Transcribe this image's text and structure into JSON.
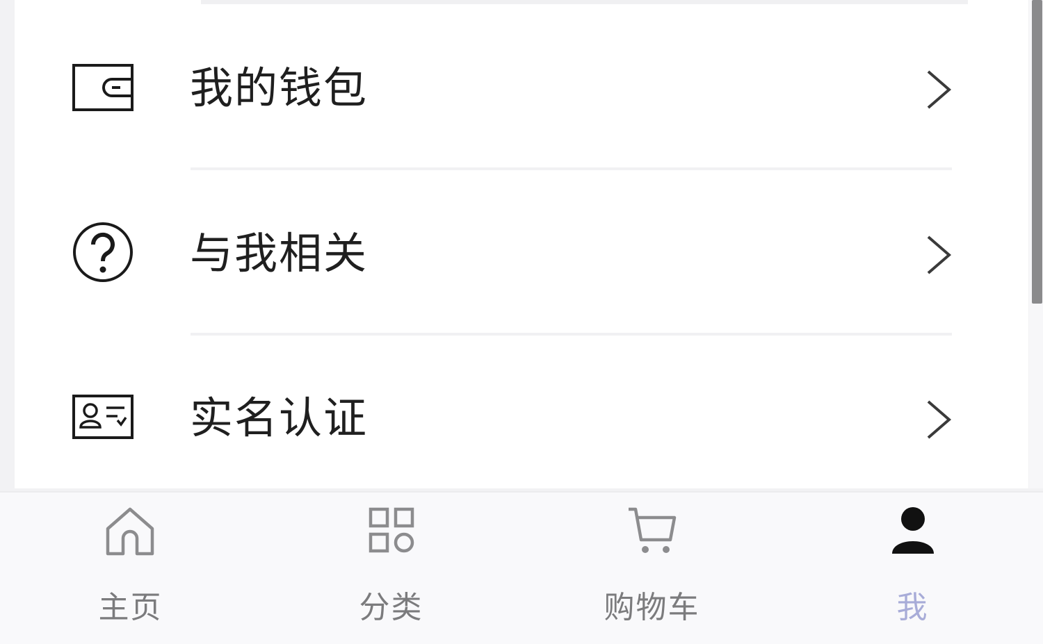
{
  "menu": {
    "items": [
      {
        "label": "我的钱包",
        "icon": "wallet-icon"
      },
      {
        "label": "与我相关",
        "icon": "question-circle-icon"
      },
      {
        "label": "实名认证",
        "icon": "id-card-icon"
      }
    ]
  },
  "tabbar": {
    "active": "我",
    "active_color": "#a8acd8",
    "tabs": [
      {
        "label": "主页",
        "icon": "home-icon"
      },
      {
        "label": "分类",
        "icon": "category-grid-icon"
      },
      {
        "label": "购物车",
        "icon": "cart-icon"
      },
      {
        "label": "我",
        "icon": "user-icon"
      }
    ]
  }
}
